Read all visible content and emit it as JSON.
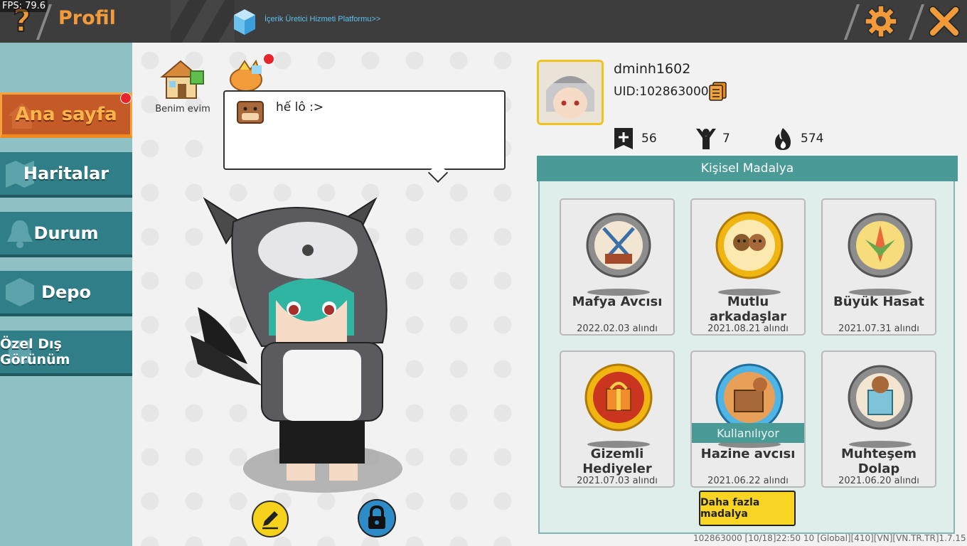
{
  "fps": "FPS: 79.6",
  "header": {
    "title": "Profil",
    "platform_link": "İçerik Üretici Hizmeti Platformu>>"
  },
  "sidebar": {
    "items": [
      {
        "label": "Ana sayfa",
        "active": true,
        "badge": true
      },
      {
        "label": "Haritalar"
      },
      {
        "label": "Durum"
      },
      {
        "label": "Depo"
      },
      {
        "label": "Özel Dış Görünüm"
      }
    ]
  },
  "home": {
    "house_label": "Benim evim",
    "status_message": "hế lô :>"
  },
  "profile": {
    "name": "dminh1602",
    "uid": "UID:102863000",
    "stats": [
      {
        "icon": "plus-icon",
        "value": "56"
      },
      {
        "icon": "cheer-icon",
        "value": "7"
      },
      {
        "icon": "flame-icon",
        "value": "574"
      }
    ]
  },
  "medals": {
    "header": "Kişisel Madalya",
    "items": [
      {
        "name": "Mafya Avcısı",
        "date": "2022.02.03 alındı",
        "tier": "silver"
      },
      {
        "name": "Mutlu arkadaşlar",
        "date": "2021.08.21 alındı",
        "tier": "gold"
      },
      {
        "name": "Büyük Hasat",
        "date": "2021.07.31 alındı",
        "tier": "silver"
      },
      {
        "name": "Gizemli Hediyeler",
        "date": "2021.07.03 alındı",
        "tier": "gold"
      },
      {
        "name": "Hazine avcısı",
        "date": "2021.06.22 alındı",
        "tier": "blue",
        "status": "Kullanılıyor"
      },
      {
        "name": "Muhteşem Dolap",
        "date": "2021.06.20 alındı",
        "tier": "silver"
      }
    ],
    "more_button": "Daha fazla madalya"
  },
  "footer": "102863000  [10/18]22:50 10  [Global][410][VN][VN.TR.TR]1.7.15",
  "colors": {
    "accent_orange": "#f39a3a",
    "teal": "#4a9a98",
    "active_tab": "#c35a28",
    "button_yellow": "#f9d523"
  }
}
